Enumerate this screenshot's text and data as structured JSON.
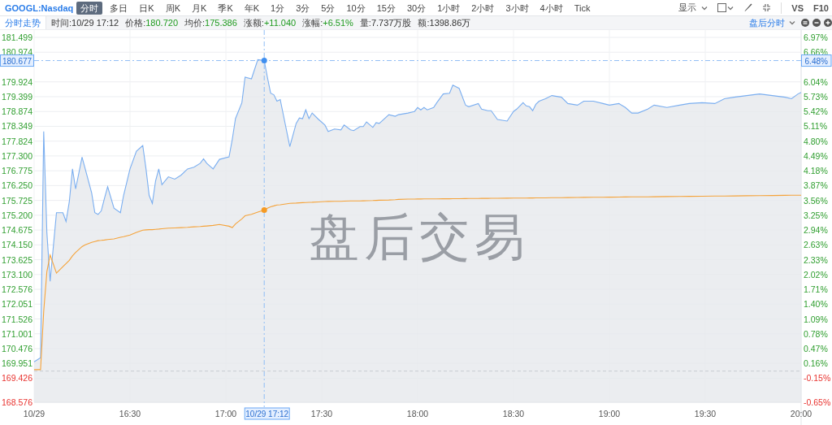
{
  "toolbar": {
    "symbol": "GOOGL:Nasdaq",
    "periods": [
      {
        "label": "分时",
        "selected": true
      },
      {
        "label": "多日",
        "selected": false
      },
      {
        "label": "日K",
        "selected": false
      },
      {
        "label": "周K",
        "selected": false
      },
      {
        "label": "月K",
        "selected": false
      },
      {
        "label": "季K",
        "selected": false
      },
      {
        "label": "年K",
        "selected": false
      },
      {
        "label": "1分",
        "selected": false
      },
      {
        "label": "3分",
        "selected": false
      },
      {
        "label": "5分",
        "selected": false
      },
      {
        "label": "10分",
        "selected": false
      },
      {
        "label": "15分",
        "selected": false
      },
      {
        "label": "30分",
        "selected": false
      },
      {
        "label": "1小时",
        "selected": false
      },
      {
        "label": "2小时",
        "selected": false
      },
      {
        "label": "3小时",
        "selected": false
      },
      {
        "label": "4小时",
        "selected": false
      },
      {
        "label": "Tick",
        "selected": false
      }
    ],
    "tools": [
      {
        "kind": "dropdown",
        "label": "显示"
      },
      {
        "kind": "checkbox",
        "checked": false
      },
      {
        "kind": "pen"
      },
      {
        "kind": "fullscreen"
      },
      {
        "kind": "text",
        "label": "VS"
      },
      {
        "kind": "text",
        "label": "F10"
      }
    ]
  },
  "info_bar": {
    "title": "分时走势",
    "fields": [
      {
        "label": "时间:",
        "value": "10/29 17:12",
        "color": "#333333"
      },
      {
        "label": "价格:",
        "value": "180.720",
        "color": "#1f9b1f"
      },
      {
        "label": "均价:",
        "value": "175.386",
        "color": "#1f9b1f"
      },
      {
        "label": "涨额:",
        "value": "+11.040",
        "color": "#1f9b1f"
      },
      {
        "label": "涨幅:",
        "value": "+6.51%",
        "color": "#1f9b1f"
      },
      {
        "label": "量:",
        "value": "7.737万股",
        "color": "#333333"
      },
      {
        "label": "额:",
        "value": "1398.86万",
        "color": "#333333"
      }
    ],
    "mode": "盘后分时",
    "zoom_buttons": [
      {
        "kind": "reset"
      },
      {
        "kind": "zoom-out"
      },
      {
        "kind": "zoom-in"
      }
    ]
  },
  "chart": {
    "background_label": "盘后交易",
    "crosshair": {
      "time": "10/29 17:12",
      "change": "6.48%"
    },
    "change_ticks": [
      "6.97%",
      "6.66%",
      "6.04%",
      "5.73%",
      "5.42%",
      "5.11%",
      "4.80%",
      "4.49%",
      "4.18%",
      "3.87%",
      "3.56%",
      "3.25%",
      "2.94%",
      "2.63%",
      "2.33%",
      "2.02%",
      "1.71%",
      "1.40%",
      "1.09%",
      "0.78%",
      "0.47%",
      "0.16%",
      "-0.15%",
      "-0.65%"
    ],
    "chart_data": {
      "type": "area",
      "grid": true,
      "xlim": [
        960,
        1200
      ],
      "ylim": [
        168.576,
        181.499
      ],
      "xticks": [
        {
          "value": 960,
          "label": "10/29"
        },
        {
          "value": 990,
          "label": "16:30"
        },
        {
          "value": 1020,
          "label": "17:00"
        },
        {
          "value": 1050,
          "label": "17:30"
        },
        {
          "value": 1080,
          "label": "18:00"
        },
        {
          "value": 1110,
          "label": "18:30"
        },
        {
          "value": 1140,
          "label": "19:00"
        },
        {
          "value": 1170,
          "label": "19:30"
        },
        {
          "value": 1200,
          "label": "20:00"
        }
      ],
      "yticks": [
        {
          "value": 181.499,
          "label": "181.499"
        },
        {
          "value": 180.974,
          "label": "180.974"
        },
        {
          "value": 179.924,
          "label": "179.924"
        },
        {
          "value": 179.399,
          "label": "179.399"
        },
        {
          "value": 178.874,
          "label": "178.874"
        },
        {
          "value": 178.349,
          "label": "178.349"
        },
        {
          "value": 177.824,
          "label": "177.824"
        },
        {
          "value": 177.3,
          "label": "177.300"
        },
        {
          "value": 176.775,
          "label": "176.775"
        },
        {
          "value": 176.25,
          "label": "176.250"
        },
        {
          "value": 175.725,
          "label": "175.725"
        },
        {
          "value": 175.2,
          "label": "175.200"
        },
        {
          "value": 174.675,
          "label": "174.675"
        },
        {
          "value": 174.15,
          "label": "174.150"
        },
        {
          "value": 173.625,
          "label": "173.625"
        },
        {
          "value": 173.1,
          "label": "173.100"
        },
        {
          "value": 172.576,
          "label": "172.576"
        },
        {
          "value": 172.051,
          "label": "172.051"
        },
        {
          "value": 171.526,
          "label": "171.526"
        },
        {
          "value": 171.001,
          "label": "171.001"
        },
        {
          "value": 170.476,
          "label": "170.476"
        },
        {
          "value": 169.951,
          "label": "169.951"
        },
        {
          "value": 169.426,
          "label": "169.426"
        },
        {
          "value": 168.576,
          "label": "168.576"
        }
      ],
      "x": [
        960,
        962,
        963,
        964,
        965,
        967,
        969,
        970,
        971,
        972,
        973,
        975,
        976,
        978,
        979,
        980,
        981,
        982,
        983,
        985,
        987,
        988,
        990,
        992,
        994,
        995,
        996,
        997,
        998,
        999,
        1000,
        1002,
        1004,
        1006,
        1008,
        1010,
        1012,
        1013,
        1014,
        1016,
        1018,
        1021,
        1022,
        1023,
        1025,
        1026,
        1028,
        1030,
        1032,
        1033,
        1034,
        1035,
        1036,
        1037,
        1040,
        1042,
        1043,
        1044,
        1045,
        1046,
        1047,
        1049,
        1051,
        1052,
        1054,
        1056,
        1057,
        1059,
        1060,
        1062,
        1063,
        1064,
        1066,
        1067,
        1068,
        1071,
        1073,
        1074,
        1077,
        1079,
        1080,
        1081,
        1082,
        1083,
        1085,
        1086,
        1088,
        1090,
        1091,
        1093,
        1095,
        1096,
        1099,
        1100,
        1102,
        1103,
        1105,
        1108,
        1110,
        1111,
        1113,
        1114,
        1115,
        1116,
        1117,
        1118,
        1120,
        1122,
        1125,
        1127,
        1130,
        1132,
        1135,
        1138,
        1140,
        1143,
        1145,
        1147,
        1149,
        1152,
        1154,
        1158,
        1162,
        1165,
        1169,
        1173,
        1176,
        1179,
        1183,
        1187,
        1191,
        1195,
        1197,
        1199,
        1200
      ],
      "series": [
        {
          "color": "#7aaef0",
          "values": [
            170.01,
            170.15,
            178.17,
            174.58,
            172.86,
            175.29,
            175.29,
            174.98,
            175.68,
            176.84,
            176.13,
            177.26,
            176.84,
            175.99,
            175.29,
            175.23,
            175.35,
            175.79,
            176.21,
            175.45,
            175.29,
            175.9,
            176.84,
            177.47,
            177.67,
            176.84,
            175.9,
            175.62,
            176.42,
            176.84,
            176.28,
            176.56,
            176.48,
            176.62,
            176.84,
            176.9,
            177.04,
            177.2,
            177.04,
            176.84,
            177.18,
            177.265,
            177.886,
            178.62,
            179.185,
            180.088,
            180.031,
            180.709,
            180.677,
            180.088,
            179.523,
            179.467,
            179.241,
            179.298,
            177.632,
            178.451,
            178.648,
            178.62,
            178.931,
            178.62,
            178.818,
            178.592,
            178.394,
            178.169,
            178.253,
            178.225,
            178.394,
            178.225,
            178.197,
            178.338,
            178.338,
            178.507,
            178.31,
            178.479,
            178.451,
            178.761,
            178.705,
            178.761,
            178.818,
            178.874,
            179.015,
            178.931,
            179.015,
            178.931,
            179.015,
            179.185,
            179.495,
            179.523,
            179.806,
            179.693,
            179.1,
            179.043,
            179.156,
            178.959,
            178.902,
            178.902,
            178.592,
            178.535,
            178.874,
            178.959,
            179.185,
            179.072,
            179.043,
            178.902,
            179.128,
            179.241,
            179.326,
            179.439,
            179.382,
            179.156,
            179.1,
            179.241,
            179.241,
            179.156,
            179.1,
            179.156,
            179.015,
            178.818,
            178.818,
            178.959,
            179.1,
            179.015,
            179.1,
            179.156,
            179.185,
            179.156,
            179.326,
            179.382,
            179.439,
            179.495,
            179.439,
            179.382,
            179.326,
            179.495,
            179.551
          ]
        },
        {
          "type": "line",
          "color": "#f5a33a",
          "values": [
            169.729,
            169.729,
            171.8,
            173.2,
            173.79,
            173.15,
            173.38,
            173.49,
            173.6,
            173.76,
            173.88,
            174.09,
            174.15,
            174.24,
            174.27,
            174.3,
            174.31,
            174.32,
            174.34,
            174.36,
            174.42,
            174.44,
            174.5,
            174.59,
            174.67,
            174.68,
            174.69,
            174.69,
            174.7,
            174.71,
            174.72,
            174.74,
            174.75,
            174.76,
            174.77,
            174.79,
            174.8,
            174.81,
            174.82,
            174.84,
            174.87,
            174.81,
            174.76,
            174.89,
            175.07,
            175.18,
            175.23,
            175.31,
            175.386,
            175.45,
            175.5,
            175.53,
            175.56,
            175.57,
            175.62,
            175.63,
            175.64,
            175.645,
            175.65,
            175.655,
            175.66,
            175.67,
            175.685,
            175.687,
            175.69,
            175.695,
            175.7,
            175.705,
            175.707,
            175.709,
            175.712,
            175.715,
            175.72,
            175.725,
            175.73,
            175.74,
            175.75,
            175.76,
            175.77,
            175.772,
            175.773,
            175.775,
            175.776,
            175.777,
            175.779,
            175.78,
            175.782,
            175.784,
            175.785,
            175.787,
            175.79,
            175.792,
            175.795,
            175.797,
            175.798,
            175.799,
            175.8,
            175.803,
            175.805,
            175.807,
            175.809,
            175.81,
            175.811,
            175.812,
            175.814,
            175.815,
            175.816,
            175.819,
            175.822,
            175.826,
            175.829,
            175.831,
            175.834,
            175.837,
            175.84,
            175.843,
            175.846,
            175.848,
            175.85,
            175.853,
            175.856,
            175.86,
            175.864,
            175.868,
            175.873,
            175.877,
            175.88,
            175.884,
            175.889,
            175.894,
            175.899,
            175.904,
            175.908,
            175.909,
            175.911
          ]
        }
      ],
      "ref_lines": [
        {
          "axis": "x",
          "value": 1032
        },
        {
          "axis": "y",
          "value": 180.677,
          "label": "180.677"
        },
        {
          "axis": "y",
          "value": 169.68
        }
      ]
    }
  }
}
